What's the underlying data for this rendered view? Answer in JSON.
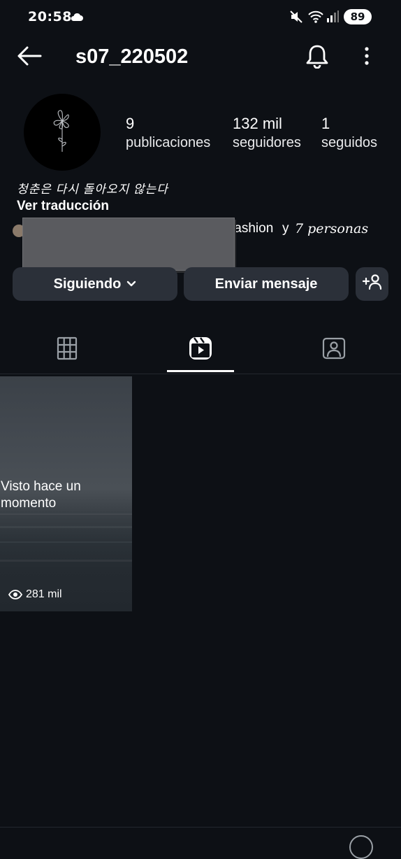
{
  "status_bar": {
    "time": "20:58",
    "battery": "89"
  },
  "header": {
    "username": "s07_220502"
  },
  "profile": {
    "stats": {
      "posts_value": "9",
      "posts_label": "publicaciones",
      "followers_value": "132 mil",
      "followers_label": "seguidores",
      "following_value": "1",
      "following_label": "seguidos"
    },
    "bio": "청춘은 다시 돌아오지 않는다",
    "translate_label": "Ver traducción",
    "followed_by": {
      "name_fragment": "fashion",
      "conjunction": "y",
      "others": "7 personas"
    }
  },
  "actions": {
    "following_label": "Siguiendo",
    "message_label": "Enviar mensaje"
  },
  "reel": {
    "viewed_label": "Visto hace un momento",
    "views": "281 mil"
  }
}
